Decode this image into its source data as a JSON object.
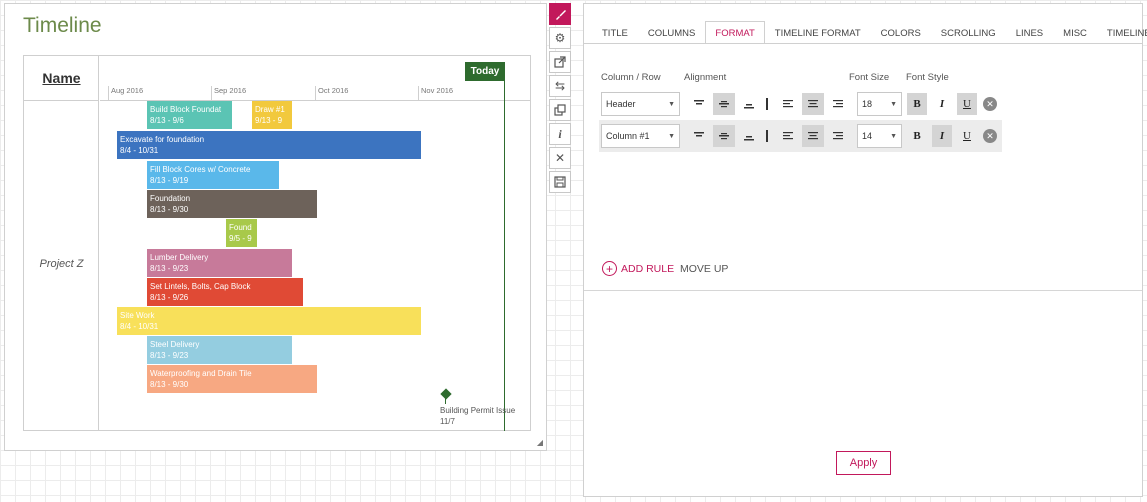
{
  "timeline": {
    "title": "Timeline",
    "name_header": "Name",
    "project_label": "Project Z",
    "months": [
      "Aug 2016",
      "Sep 2016",
      "Oct 2016",
      "Nov 2016"
    ],
    "today_label": "Today",
    "tasks": [
      {
        "name": "Build Block Foundat",
        "dates": "8/13 - 9/6",
        "color": "#5bc4b4"
      },
      {
        "name": "Draw #1",
        "dates": "9/13 - 9",
        "color": "#f2c93d"
      },
      {
        "name": "Excavate for foundation",
        "dates": "8/4 - 10/31",
        "color": "#3c74c0"
      },
      {
        "name": "Fill Block Cores w/ Concrete",
        "dates": "8/13 - 9/19",
        "color": "#5ab8ea"
      },
      {
        "name": "Foundation",
        "dates": "8/13 - 9/30",
        "color": "#6d625a"
      },
      {
        "name": "Found",
        "dates": "9/5 - 9",
        "color": "#a8c94a"
      },
      {
        "name": "Lumber Delivery",
        "dates": "8/13 - 9/23",
        "color": "#c77a9a"
      },
      {
        "name": "Set Lintels, Bolts, Cap Block",
        "dates": "8/13 - 9/26",
        "color": "#e04a35"
      },
      {
        "name": "Site Work",
        "dates": "8/4 - 10/31",
        "color": "#f8e05a"
      },
      {
        "name": "Steel Delivery",
        "dates": "8/13 - 9/23",
        "color": "#94cde0"
      },
      {
        "name": "Waterproofing and Drain Tile",
        "dates": "8/13 - 9/30",
        "color": "#f7a882"
      }
    ],
    "milestone": {
      "name": "Building Permit Issue",
      "date": "11/7",
      "color": "#2e6b2e"
    }
  },
  "toolbar": {
    "icons": [
      "brush-icon",
      "gear-icon",
      "external-link-icon",
      "swap-icon",
      "copy-icon",
      "info-icon",
      "close-icon",
      "save-icon"
    ]
  },
  "format_panel": {
    "tabs": [
      "TITLE",
      "COLUMNS",
      "FORMAT",
      "TIMELINE FORMAT",
      "COLORS",
      "SCROLLING",
      "LINES",
      "MISC",
      "TIMELINE"
    ],
    "active_tab": "FORMAT",
    "labels": {
      "column_row": "Column / Row",
      "alignment": "Alignment",
      "font_size": "Font Size",
      "font_style": "Font Style"
    },
    "rules": [
      {
        "target": "Header",
        "font_size": "18"
      },
      {
        "target": "Column #1",
        "font_size": "14"
      }
    ],
    "style_buttons": {
      "bold": "B",
      "italic": "I",
      "underline": "U"
    },
    "add_rule": "ADD RULE",
    "move_up": "MOVE UP",
    "apply": "Apply"
  },
  "colors": {
    "accent": "#c2185b",
    "title_green": "#6c8a4a",
    "today_green": "#2e6b2e"
  }
}
